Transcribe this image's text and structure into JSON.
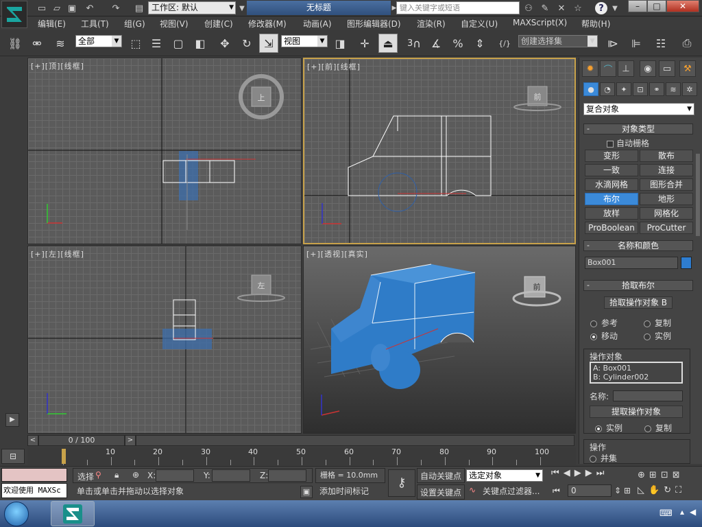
{
  "title_bar": {
    "workspace_label": "工作区: 默认",
    "document_title": "无标题",
    "search_placeholder": "键入关键字或短语"
  },
  "menu": {
    "items": [
      "编辑(E)",
      "工具(T)",
      "组(G)",
      "视图(V)",
      "创建(C)",
      "修改器(M)",
      "动画(A)",
      "图形编辑器(D)",
      "渲染(R)",
      "自定义(U)",
      "MAXScript(X)",
      "帮助(H)"
    ]
  },
  "toolbar": {
    "filter_value": "全部",
    "ref_coord_value": "视图",
    "snap_value": "3",
    "selection_set_placeholder": "创建选择集"
  },
  "viewports": {
    "top": {
      "label": "[+][顶][线框]",
      "cube_label": "上"
    },
    "front": {
      "label": "[+][前][线框]",
      "cube_label": "前"
    },
    "left": {
      "label": "[+][左][线框]",
      "cube_label": "左"
    },
    "perspective": {
      "label": "[+][透视][真实]",
      "cube_label": "前"
    }
  },
  "command_panel": {
    "category_dropdown": "复合对象",
    "object_type": {
      "title": "对象类型",
      "autogrid": "自动栅格",
      "buttons": [
        "变形",
        "散布",
        "一致",
        "连接",
        "水滴网格",
        "图形合并",
        "布尔",
        "地形",
        "放样",
        "网格化",
        "ProBoolean",
        "ProCutter"
      ],
      "active": "布尔"
    },
    "name_color": {
      "title": "名称和颜色",
      "name": "Box001",
      "color": "#2e7dd0"
    },
    "pick_boolean": {
      "title": "拾取布尔",
      "pick_button": "拾取操作对象 B",
      "options": [
        "参考",
        "复制",
        "移动",
        "实例"
      ],
      "selected": "移动"
    },
    "operands": {
      "title": "操作对象",
      "items": [
        "A: Box001",
        "B: Cylinder002"
      ],
      "name_label": "名称:",
      "extract_button": "提取操作对象",
      "instance": "实例",
      "copy": "复制"
    },
    "operation": {
      "title": "操作",
      "union": "并集"
    }
  },
  "time": {
    "frame_counter": "0 / 100",
    "ticks": [
      "0",
      "10",
      "20",
      "30",
      "40",
      "50",
      "60",
      "70",
      "80",
      "90",
      "100"
    ]
  },
  "status": {
    "welcome": "欢迎使用 MAXSc",
    "select_label": "选择",
    "x_label": "X:",
    "y_label": "Y:",
    "z_label": "Z:",
    "grid": "栅格 = 10.0mm",
    "prompt": "单击或单击并拖动以选择对象",
    "add_time_tag": "添加时间标记",
    "auto_key": "自动关键点",
    "set_key": "设置关键点",
    "key_mode_value": "选定对象",
    "key_filters": "关键点过滤器...",
    "current_frame": "0"
  }
}
